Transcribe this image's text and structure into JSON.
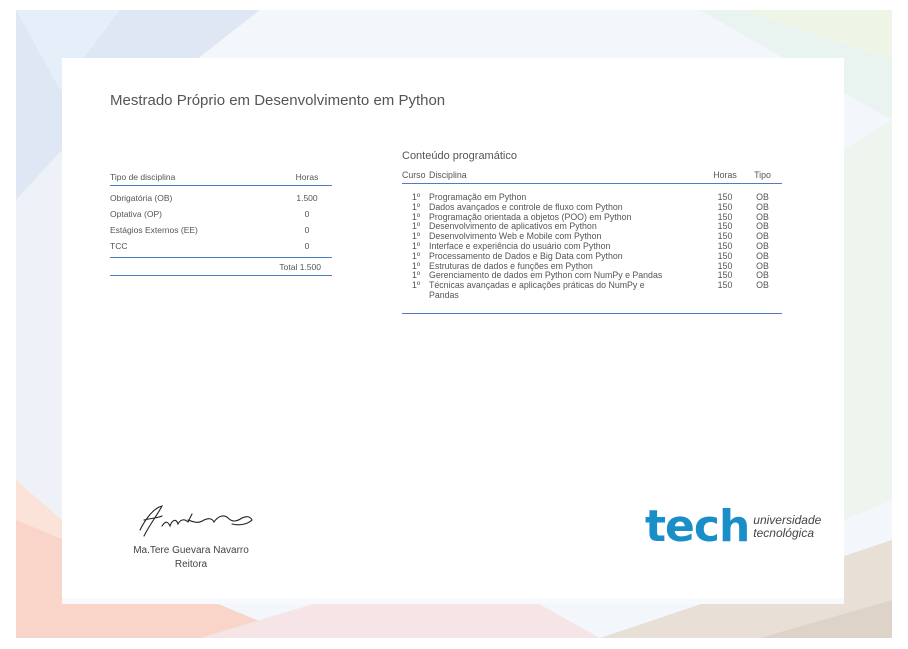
{
  "title": "Mestrado Próprio em Desenvolvimento em Python",
  "summary": {
    "header": {
      "type": "Tipo de disciplina",
      "hours": "Horas"
    },
    "rows": [
      {
        "type": "Obrigatória (OB)",
        "hours": "1.500"
      },
      {
        "type": "Optativa (OP)",
        "hours": "0"
      },
      {
        "type": "Estágios Externos (EE)",
        "hours": "0"
      },
      {
        "type": "TCC",
        "hours": "0"
      }
    ],
    "total": "Total 1.500"
  },
  "program": {
    "title": "Conteúdo programático",
    "header": {
      "course": "Curso",
      "subject": "Disciplina",
      "hours": "Horas",
      "type": "Tipo"
    },
    "rows": [
      {
        "course": "1º",
        "subject": "Programação em Python",
        "hours": "150",
        "type": "OB"
      },
      {
        "course": "1º",
        "subject": "Dados avançados e controle de fluxo com Python",
        "hours": "150",
        "type": "OB"
      },
      {
        "course": "1º",
        "subject": "Programação orientada a objetos (POO) em Python",
        "hours": "150",
        "type": "OB"
      },
      {
        "course": "1º",
        "subject": "Desenvolvimento de aplicativos em Python",
        "hours": "150",
        "type": "OB"
      },
      {
        "course": "1º",
        "subject": "Desenvolvimento Web e Mobile com Python",
        "hours": "150",
        "type": "OB"
      },
      {
        "course": "1º",
        "subject": "Interface e experiência do usuário com Python",
        "hours": "150",
        "type": "OB"
      },
      {
        "course": "1º",
        "subject": "Processamento de Dados e Big Data com Python",
        "hours": "150",
        "type": "OB"
      },
      {
        "course": "1º",
        "subject": "Estruturas de dados e funções em Python",
        "hours": "150",
        "type": "OB"
      },
      {
        "course": "1º",
        "subject": "Gerenciamento de dados em Python com NumPy e Pandas",
        "hours": "150",
        "type": "OB"
      },
      {
        "course": "1º",
        "subject": "Técnicas avançadas e aplicações práticas do NumPy e",
        "hours": "150",
        "type": "OB"
      },
      {
        "course": "",
        "subject": "Pandas",
        "hours": "",
        "type": ""
      }
    ]
  },
  "signatory": {
    "name": "Ma.Tere Guevara Navarro",
    "role": "Reitora"
  },
  "logo": {
    "brand": "tech",
    "line1": "universidade",
    "line2": "tecnológica"
  },
  "colors": {
    "accent": "#4a7fc1",
    "brand": "#1a8ec9"
  }
}
